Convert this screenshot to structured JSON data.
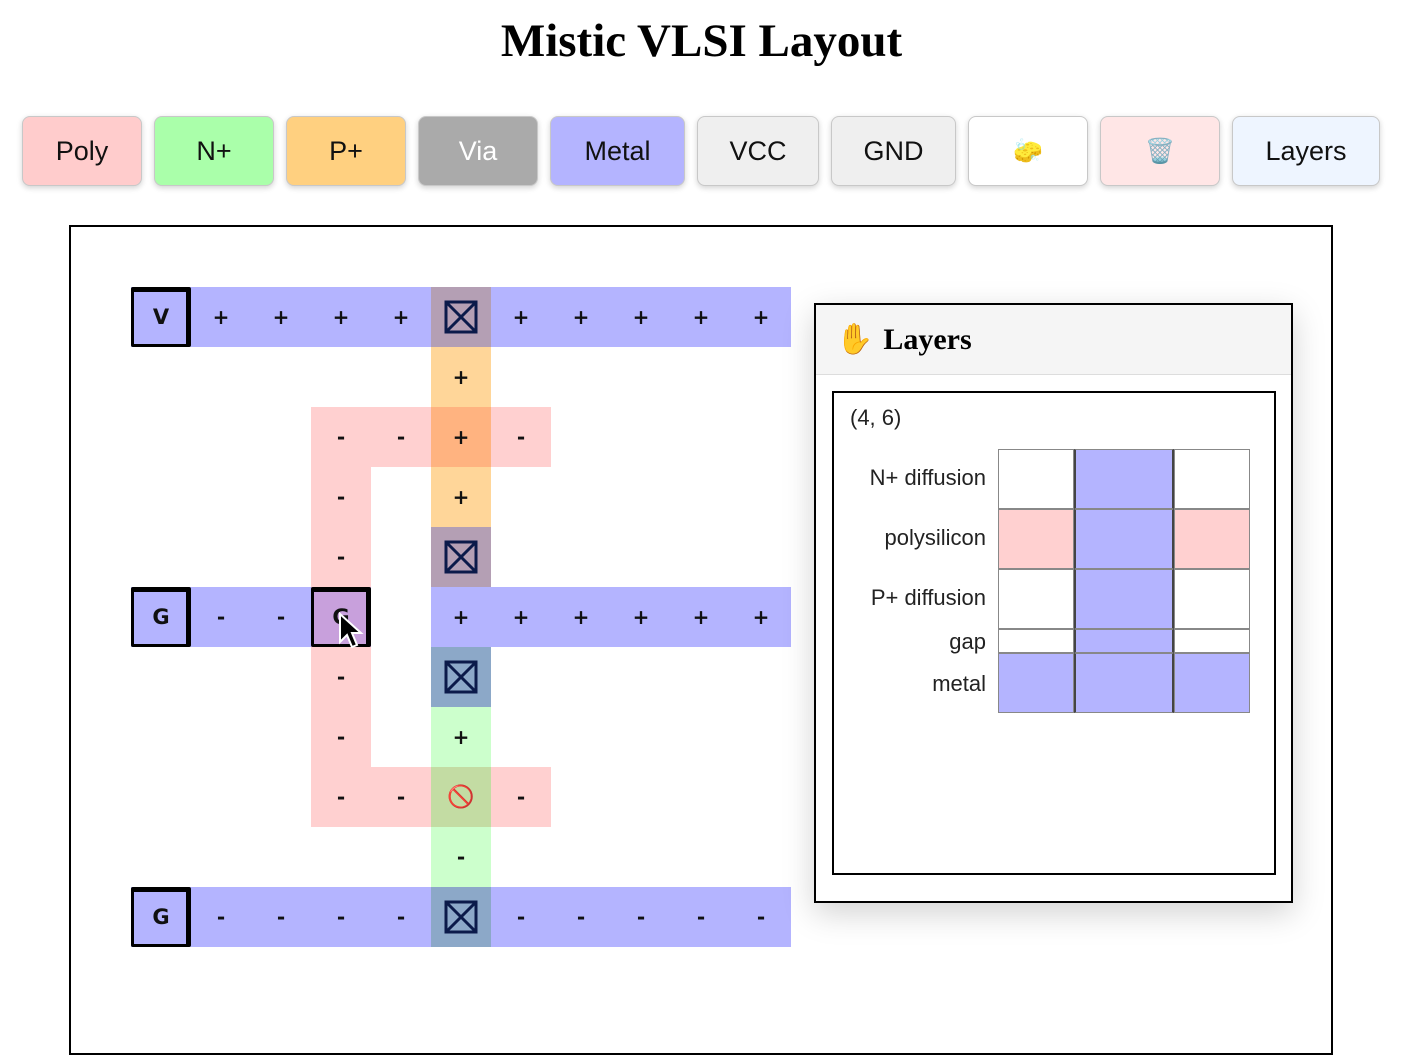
{
  "title": "Mistic VLSI Layout",
  "toolbar": {
    "buttons": [
      {
        "name": "poly-button",
        "label": "Poly",
        "bg": "#ffcccc",
        "color": "#111"
      },
      {
        "name": "n-plus-button",
        "label": "N+",
        "bg": "#aaffaa",
        "color": "#111"
      },
      {
        "name": "p-plus-button",
        "label": "P+",
        "bg": "#ffd080",
        "color": "#111"
      },
      {
        "name": "via-button",
        "label": "Via",
        "bg": "#aaaaaa",
        "color": "#ffffff"
      },
      {
        "name": "metal-button",
        "label": "Metal",
        "bg": "#b4b4ff",
        "color": "#111"
      },
      {
        "name": "vcc-button",
        "label": "VCC",
        "bg": "#efefef",
        "color": "#111"
      },
      {
        "name": "gnd-button",
        "label": "GND",
        "bg": "#efefef",
        "color": "#111"
      },
      {
        "name": "eraser-button",
        "label": "🧽",
        "bg": "#ffffff",
        "color": "#111",
        "icon": "sponge-icon"
      },
      {
        "name": "clear-button",
        "label": "🗑️",
        "bg": "#ffe6e6",
        "color": "#111",
        "icon": "trash-icon"
      },
      {
        "name": "layers-button",
        "label": "Layers",
        "bg": "#eef5ff",
        "color": "#111"
      }
    ]
  },
  "colors": {
    "metal": "#b4b4ff",
    "poly": "#ffd0d0",
    "pdiff": "#ffd699",
    "ndiff": "#ccffcc",
    "poly_over_pdiff": "#ffb380",
    "poly_over_ndiff": "#c3dca3",
    "metal_over_pdiff": "#b49fb4",
    "metal_over_ndiff": "#8ca8c8",
    "metal_over_poly": "#c8a0dc"
  },
  "grid": {
    "cells": [
      {
        "r": 0,
        "c": 0,
        "layer": "metal",
        "term": "V"
      },
      {
        "r": 0,
        "c": 1,
        "layer": "metal",
        "label": "+"
      },
      {
        "r": 0,
        "c": 2,
        "layer": "metal",
        "label": "+"
      },
      {
        "r": 0,
        "c": 3,
        "layer": "metal",
        "label": "+"
      },
      {
        "r": 0,
        "c": 4,
        "layer": "metal",
        "label": "+"
      },
      {
        "r": 0,
        "c": 5,
        "layer": "metal_over_pdiff",
        "via": true
      },
      {
        "r": 0,
        "c": 6,
        "layer": "metal",
        "label": "+"
      },
      {
        "r": 0,
        "c": 7,
        "layer": "metal",
        "label": "+"
      },
      {
        "r": 0,
        "c": 8,
        "layer": "metal",
        "label": "+"
      },
      {
        "r": 0,
        "c": 9,
        "layer": "metal",
        "label": "+"
      },
      {
        "r": 0,
        "c": 10,
        "layer": "metal",
        "label": "+"
      },
      {
        "r": 1,
        "c": 5,
        "layer": "pdiff",
        "label": "+"
      },
      {
        "r": 2,
        "c": 3,
        "layer": "poly",
        "label": "-"
      },
      {
        "r": 2,
        "c": 4,
        "layer": "poly",
        "label": "-"
      },
      {
        "r": 2,
        "c": 5,
        "layer": "poly_over_pdiff",
        "label": "+"
      },
      {
        "r": 2,
        "c": 6,
        "layer": "poly",
        "label": "-"
      },
      {
        "r": 3,
        "c": 3,
        "layer": "poly",
        "label": "-"
      },
      {
        "r": 3,
        "c": 5,
        "layer": "pdiff",
        "label": "+"
      },
      {
        "r": 4,
        "c": 3,
        "layer": "poly",
        "label": "-"
      },
      {
        "r": 4,
        "c": 5,
        "layer": "metal_over_pdiff",
        "via": true
      },
      {
        "r": 5,
        "c": 0,
        "layer": "metal",
        "term": "G"
      },
      {
        "r": 5,
        "c": 1,
        "layer": "metal",
        "label": "-"
      },
      {
        "r": 5,
        "c": 2,
        "layer": "metal",
        "label": "-"
      },
      {
        "r": 5,
        "c": 3,
        "layer": "metal_over_poly",
        "term": "G"
      },
      {
        "r": 5,
        "c": 5,
        "layer": "metal",
        "label": "+"
      },
      {
        "r": 5,
        "c": 6,
        "layer": "metal",
        "label": "+"
      },
      {
        "r": 5,
        "c": 7,
        "layer": "metal",
        "label": "+"
      },
      {
        "r": 5,
        "c": 8,
        "layer": "metal",
        "label": "+"
      },
      {
        "r": 5,
        "c": 9,
        "layer": "metal",
        "label": "+"
      },
      {
        "r": 5,
        "c": 10,
        "layer": "metal",
        "label": "+"
      },
      {
        "r": 6,
        "c": 3,
        "layer": "poly",
        "label": "-"
      },
      {
        "r": 6,
        "c": 5,
        "layer": "metal_over_ndiff",
        "via": true
      },
      {
        "r": 7,
        "c": 3,
        "layer": "poly",
        "label": "-"
      },
      {
        "r": 7,
        "c": 5,
        "layer": "ndiff",
        "label": "+"
      },
      {
        "r": 8,
        "c": 3,
        "layer": "poly",
        "label": "-"
      },
      {
        "r": 8,
        "c": 4,
        "layer": "poly",
        "label": "-"
      },
      {
        "r": 8,
        "c": 5,
        "layer": "poly_over_ndiff",
        "label": "🚫",
        "icon": "prohibited-icon"
      },
      {
        "r": 8,
        "c": 6,
        "layer": "poly",
        "label": "-"
      },
      {
        "r": 9,
        "c": 5,
        "layer": "ndiff",
        "label": "-"
      },
      {
        "r": 10,
        "c": 0,
        "layer": "metal",
        "term": "G"
      },
      {
        "r": 10,
        "c": 1,
        "layer": "metal",
        "label": "-"
      },
      {
        "r": 10,
        "c": 2,
        "layer": "metal",
        "label": "-"
      },
      {
        "r": 10,
        "c": 3,
        "layer": "metal",
        "label": "-"
      },
      {
        "r": 10,
        "c": 4,
        "layer": "metal",
        "label": "-"
      },
      {
        "r": 10,
        "c": 5,
        "layer": "metal_over_ndiff",
        "via": true
      },
      {
        "r": 10,
        "c": 6,
        "layer": "metal",
        "label": "-"
      },
      {
        "r": 10,
        "c": 7,
        "layer": "metal",
        "label": "-"
      },
      {
        "r": 10,
        "c": 8,
        "layer": "metal",
        "label": "-"
      },
      {
        "r": 10,
        "c": 9,
        "layer": "metal",
        "label": "-"
      },
      {
        "r": 10,
        "c": 10,
        "layer": "metal",
        "label": "-"
      }
    ]
  },
  "layers_panel": {
    "icon": "hand-icon",
    "icon_glyph": "✋",
    "title": "Layers",
    "coord": "(4, 6)",
    "rows": [
      {
        "label": "N+ diffusion",
        "cells": [
          "#ffffff",
          "#b4b4ff",
          "#ffffff"
        ]
      },
      {
        "label": "polysilicon",
        "cells": [
          "#ffd0d0",
          "#b4b4ff",
          "#ffd0d0"
        ]
      },
      {
        "label": "P+ diffusion",
        "cells": [
          "#ffffff",
          "#b4b4ff",
          "#ffffff"
        ]
      },
      {
        "label": "gap",
        "cells": [
          "#ffffff",
          "#b4b4ff",
          "#ffffff"
        ]
      },
      {
        "label": "metal",
        "cells": [
          "#b4b4ff",
          "#b4b4ff",
          "#b4b4ff"
        ]
      }
    ]
  }
}
